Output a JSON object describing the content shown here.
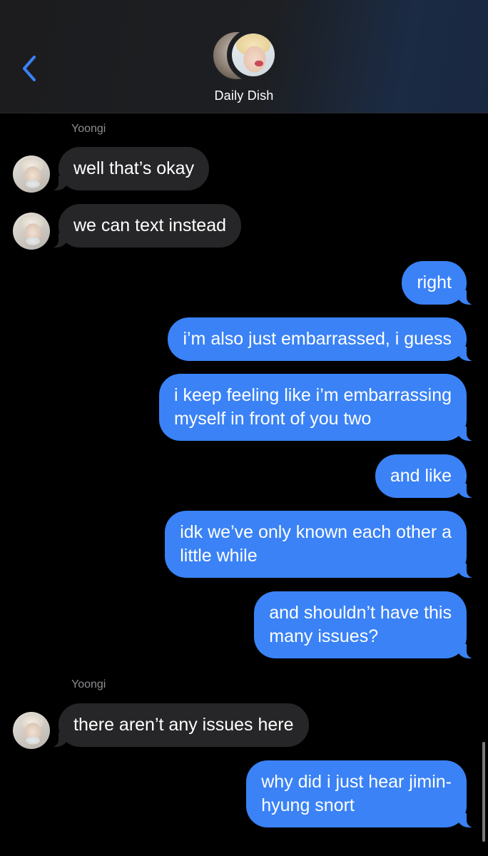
{
  "header": {
    "contact_name": "Daily Dish",
    "back_icon": "chevron-left-icon",
    "accent": "#3a82f6"
  },
  "colors": {
    "background": "#000000",
    "incoming_bubble": "#262628",
    "outgoing_bubble": "#3a82f6",
    "sender_label": "#8e8e93"
  },
  "messages": [
    {
      "sender": "Yoongi",
      "direction": "incoming",
      "text": "well that’s okay"
    },
    {
      "direction": "incoming",
      "text": "we can text instead"
    },
    {
      "direction": "outgoing",
      "text": "right"
    },
    {
      "direction": "outgoing",
      "text": "i’m also just embarrassed, i guess"
    },
    {
      "direction": "outgoing",
      "text": "i keep feeling like i’m embarrassing\nmyself in front of you two"
    },
    {
      "direction": "outgoing",
      "text": "and like"
    },
    {
      "direction": "outgoing",
      "text": "idk we’ve only known each other a\nlittle while"
    },
    {
      "direction": "outgoing",
      "text": "and shouldn’t have this\nmany issues?"
    },
    {
      "sender": "Yoongi",
      "direction": "incoming",
      "text": "there aren’t any issues here"
    },
    {
      "direction": "outgoing",
      "text": "why did i just hear jimin-\nhyung snort"
    }
  ]
}
